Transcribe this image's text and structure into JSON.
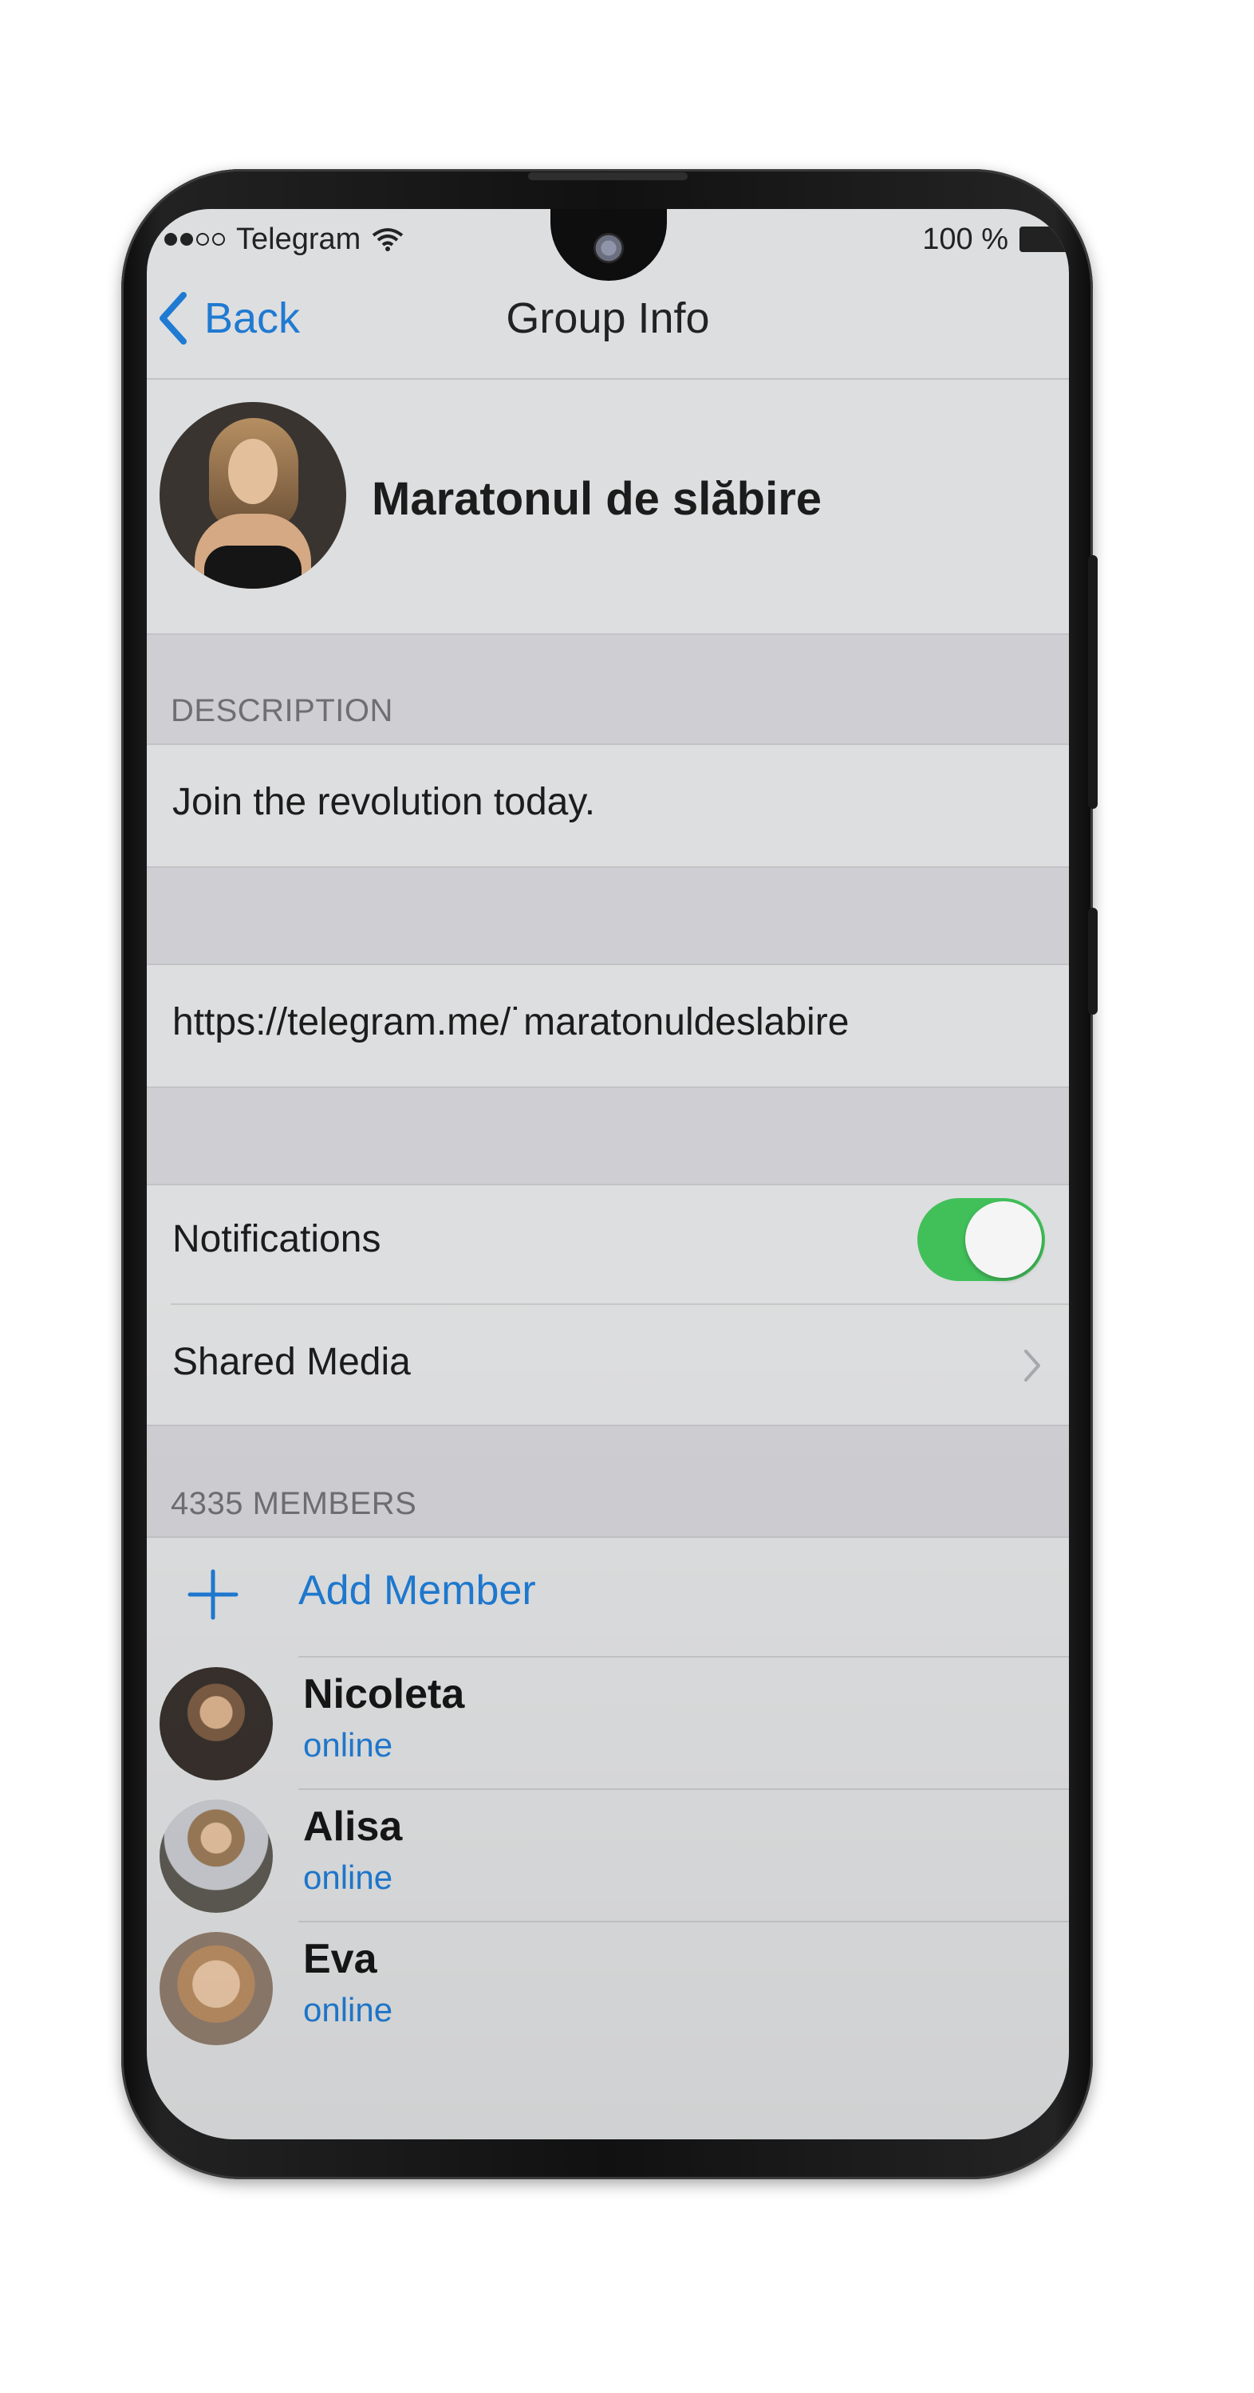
{
  "status_bar": {
    "carrier": "Telegram",
    "battery": "100 %"
  },
  "nav": {
    "back_label": "Back",
    "title": "Group Info"
  },
  "group": {
    "name": "Maratonul de slăbire"
  },
  "description": {
    "header": "DESCRIPTION",
    "text": "Join the revolution today."
  },
  "link": {
    "url": "https://telegram.me/˙maratonuldeslabire"
  },
  "settings": {
    "notifications_label": "Notifications",
    "notifications_on": true,
    "shared_media_label": "Shared Media"
  },
  "members": {
    "header": "4335 MEMBERS",
    "add_label": "Add Member",
    "list": [
      {
        "name": "Nicoleta",
        "status": "online"
      },
      {
        "name": "Alisa",
        "status": "online"
      },
      {
        "name": "Eva",
        "status": "online"
      }
    ]
  },
  "colors": {
    "accent": "#1f7ad2",
    "toggle_on": "#41c05a",
    "section_bg": "#cfcfd3",
    "screen_bg": "#dddedf"
  }
}
